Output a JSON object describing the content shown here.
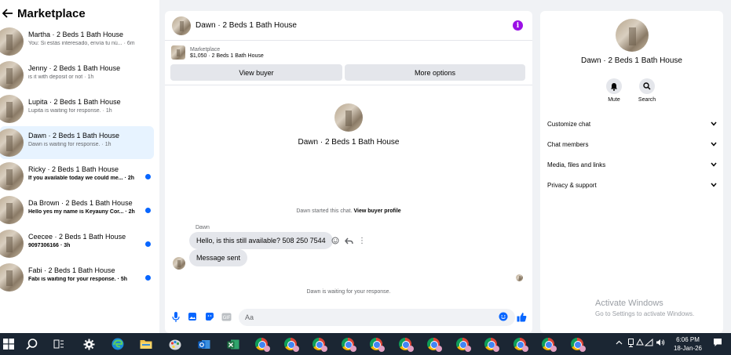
{
  "left": {
    "title": "Marketplace",
    "conversations": [
      {
        "name": "Martha · 2 Beds 1 Bath House",
        "preview": "You: Si estás interesado, envía tu nú...",
        "time": "· 6m",
        "unread": false
      },
      {
        "name": "Jenny · 2 Beds 1 Bath House",
        "preview": "is it with deposit or not",
        "time": "· 1h",
        "unread": false
      },
      {
        "name": "Lupita · 2 Beds 1 Bath House",
        "preview": "Lupita is waiting for response.",
        "time": "· 1h",
        "unread": false
      },
      {
        "name": "Dawn · 2 Beds 1 Bath House",
        "preview": "Dawn is waiting for response.",
        "time": "· 1h",
        "unread": false
      },
      {
        "name": "Ricky · 2 Beds 1 Bath House",
        "preview": "If you available today we could me...",
        "time": "· 2h",
        "unread": true
      },
      {
        "name": "Da Brown · 2 Beds 1 Bath House",
        "preview": "Hello yes my name is Keyauny Cor...",
        "time": "· 2h",
        "unread": true
      },
      {
        "name": "Ceecee · 2 Beds 1 Bath House",
        "preview": "9097306166",
        "time": "· 3h",
        "unread": true
      },
      {
        "name": "Fabi · 2 Beds 1 Bath House",
        "preview": "Fabi is waiting for your response.",
        "time": "· 5h",
        "unread": true
      }
    ]
  },
  "center": {
    "title": "Dawn · 2 Beds 1 Bath House",
    "listing_label": "Marketplace",
    "listing_price": "$1,050 · 2 Beds 1 Bath House",
    "view_buyer": "View buyer",
    "more_options": "More options",
    "hero_name": "Dawn · 2 Beds 1 Bath House",
    "started_text": "Dawn started this chat.",
    "view_profile": "View buyer profile",
    "sender": "Dawn",
    "msg1": "Hello, is this still available? 508 250 7544",
    "msg2": "Message sent",
    "waiting": "Dawn is waiting for your response.",
    "input_placeholder": "Aa"
  },
  "right": {
    "name": "Dawn · 2 Beds 1 Bath House",
    "mute": "Mute",
    "search": "Search",
    "rows": [
      "Customize chat",
      "Chat members",
      "Media, files and links",
      "Privacy & support"
    ],
    "activate_title": "Activate Windows",
    "activate_sub": "Go to Settings to activate Windows."
  },
  "taskbar": {
    "time": "6:06 PM",
    "date": "18-Jan-26"
  },
  "colors": {
    "accent": "#0866ff",
    "info": "#9b10e6"
  }
}
